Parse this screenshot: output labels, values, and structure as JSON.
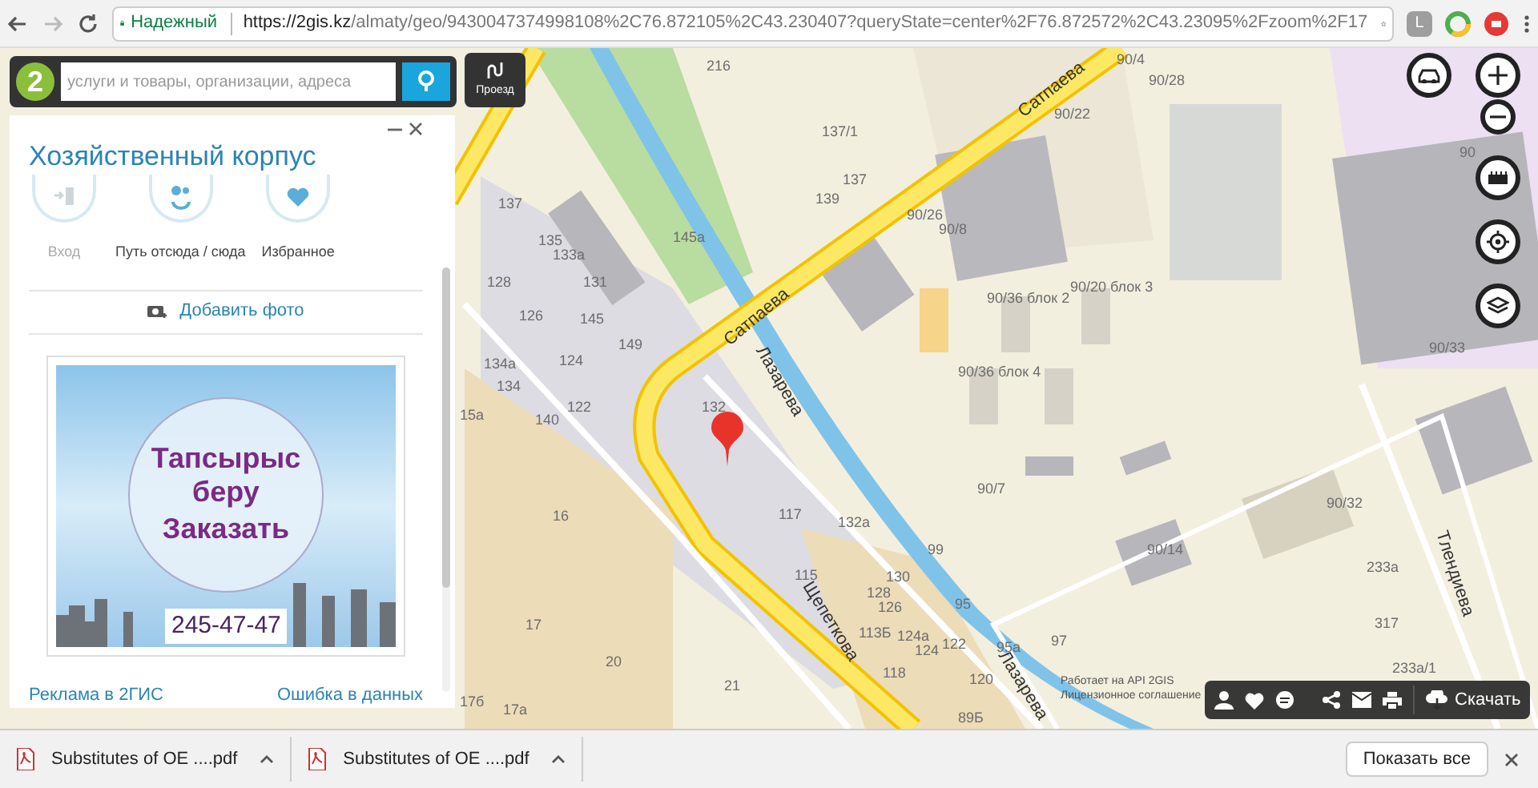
{
  "browser": {
    "security": "Надежный",
    "url_host": "https://2gis.kz",
    "url_path": "/almaty/geo/9430047374998108%2C76.872105%2C43.230407?queryState=center%2F76.872572%2C43.23095%2Fzoom%2F17",
    "extension_letter": "L"
  },
  "search": {
    "logo": "2",
    "placeholder": "услуги и товары, организации, адреса",
    "route_button": "Проезд"
  },
  "card": {
    "title": "Хозяйственный корпус",
    "actions": [
      {
        "label": "Вход",
        "disabled": true
      },
      {
        "label": "Путь отсюда / сюда",
        "disabled": false
      },
      {
        "label": "Избранное",
        "disabled": false
      }
    ],
    "add_photo": "Добавить фото",
    "ad": {
      "lines": [
        "Тапсырыс",
        "беру",
        "Заказать"
      ],
      "phone": "245-47-47"
    },
    "links": [
      "Реклама в 2ГИС",
      "Ошибка в данных"
    ]
  },
  "map": {
    "labels": [
      {
        "text": "216",
        "kind": "building"
      },
      {
        "text": "137/1",
        "kind": "building"
      },
      {
        "text": "137",
        "kind": "building"
      },
      {
        "text": "139",
        "kind": "building"
      },
      {
        "text": "137",
        "kind": "building"
      },
      {
        "text": "145а",
        "kind": "building"
      },
      {
        "text": "135",
        "kind": "building"
      },
      {
        "text": "133а",
        "kind": "building"
      },
      {
        "text": "128",
        "kind": "building"
      },
      {
        "text": "131",
        "kind": "building"
      },
      {
        "text": "126",
        "kind": "building"
      },
      {
        "text": "145",
        "kind": "building"
      },
      {
        "text": "149",
        "kind": "building"
      },
      {
        "text": "124",
        "kind": "building"
      },
      {
        "text": "134а",
        "kind": "building"
      },
      {
        "text": "134",
        "kind": "building"
      },
      {
        "text": "122",
        "kind": "building"
      },
      {
        "text": "140",
        "kind": "building"
      },
      {
        "text": "15а",
        "kind": "building"
      },
      {
        "text": "132",
        "kind": "building"
      },
      {
        "text": "117",
        "kind": "building"
      },
      {
        "text": "132а",
        "kind": "building"
      },
      {
        "text": "16",
        "kind": "building"
      },
      {
        "text": "99",
        "kind": "building"
      },
      {
        "text": "115",
        "kind": "building"
      },
      {
        "text": "130",
        "kind": "building"
      },
      {
        "text": "128",
        "kind": "building"
      },
      {
        "text": "126",
        "kind": "building"
      },
      {
        "text": "95",
        "kind": "building"
      },
      {
        "text": "17",
        "kind": "building"
      },
      {
        "text": "113Б",
        "kind": "building"
      },
      {
        "text": "124а",
        "kind": "building"
      },
      {
        "text": "124",
        "kind": "building"
      },
      {
        "text": "122",
        "kind": "building"
      },
      {
        "text": "95а",
        "kind": "building"
      },
      {
        "text": "118",
        "kind": "building"
      },
      {
        "text": "97",
        "kind": "building"
      },
      {
        "text": "120",
        "kind": "building"
      },
      {
        "text": "20",
        "kind": "building"
      },
      {
        "text": "21",
        "kind": "building"
      },
      {
        "text": "17б",
        "kind": "building"
      },
      {
        "text": "17а",
        "kind": "building"
      },
      {
        "text": "90/4",
        "kind": "building"
      },
      {
        "text": "90/28",
        "kind": "building"
      },
      {
        "text": "90/22",
        "kind": "building"
      },
      {
        "text": "90",
        "kind": "building"
      },
      {
        "text": "90/26",
        "kind": "building"
      },
      {
        "text": "90/8",
        "kind": "building"
      },
      {
        "text": "90/36 блок 2",
        "kind": "building"
      },
      {
        "text": "90/20 блок 3",
        "kind": "building"
      },
      {
        "text": "90/36 блок 4",
        "kind": "building"
      },
      {
        "text": "90/33",
        "kind": "building"
      },
      {
        "text": "90/7",
        "kind": "building"
      },
      {
        "text": "90/32",
        "kind": "building"
      },
      {
        "text": "90/14",
        "kind": "building"
      },
      {
        "text": "233а",
        "kind": "building"
      },
      {
        "text": "317",
        "kind": "building"
      },
      {
        "text": "233а/1",
        "kind": "building"
      },
      {
        "text": "89Б",
        "kind": "building"
      },
      {
        "text": "Сатпаева",
        "kind": "street"
      },
      {
        "text": "Сатпаева",
        "kind": "street"
      },
      {
        "text": "Лазарева",
        "kind": "street"
      },
      {
        "text": "Щепеткова",
        "kind": "street"
      },
      {
        "text": "Лазарева",
        "kind": "street"
      },
      {
        "text": "Тлендиева",
        "kind": "street"
      }
    ],
    "attribution": [
      "Работает на API 2GIS",
      "Лицензионное соглашение"
    ]
  },
  "map_toolbar": {
    "download": "Скачать"
  },
  "downloads": {
    "items": [
      {
        "name": "Substitutes of OE ....pdf"
      },
      {
        "name": "Substitutes of OE ....pdf"
      }
    ],
    "show_all": "Показать все"
  }
}
